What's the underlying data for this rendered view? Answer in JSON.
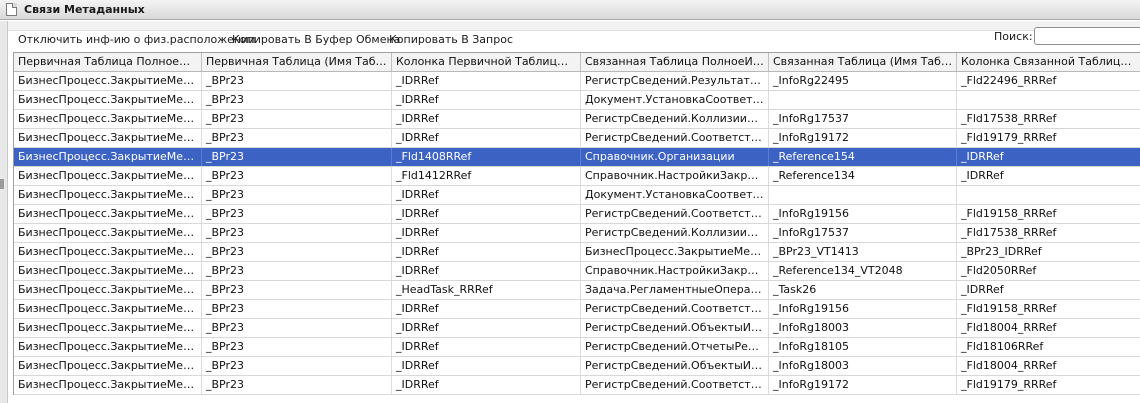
{
  "window": {
    "title": "Связи Метаданных"
  },
  "toolbar": {
    "disable_info": "Отключить инф-ию о физ.расположении",
    "copy_clipboard": "Копировать В Буфер Обмена",
    "copy_query": "Копировать В Запрос"
  },
  "search": {
    "label": "Поиск:",
    "value": ""
  },
  "table": {
    "headers": [
      "Первичная Таблица ПолноеИмя",
      "Первичная Таблица (Имя Таблиц...",
      "Колонка Первичной Таблицы (Им...",
      "Связанная Таблица ПолноеИмя",
      "Связанная Таблица (Имя Таблиц...",
      "Колонка Связанной Таблицы (Им..."
    ],
    "selected_row": 4,
    "rows": [
      [
        "БизнесПроцесс.ЗакрытиеМесяца",
        "_BPr23",
        "_IDRRef",
        "РегистрСведений.РезультатыОб...",
        "_InfoRg22495",
        "_Fld22496_RRRef"
      ],
      [
        "БизнесПроцесс.ЗакрытиеМесяца",
        "_BPr23",
        "_IDRRef",
        "Документ.УстановкаСоответств...",
        "",
        ""
      ],
      [
        "БизнесПроцесс.ЗакрытиеМесяца",
        "_BPr23",
        "_IDRRef",
        "РегистрСведений.КоллизииПриО...",
        "_InfoRg17537",
        "_Fld17538_RRRef"
      ],
      [
        "БизнесПроцесс.ЗакрытиеМесяца",
        "_BPr23",
        "_IDRRef",
        "РегистрСведений.СоответствиеС...",
        "_InfoRg19172",
        "_Fld19179_RRRef"
      ],
      [
        "БизнесПроцесс.ЗакрытиеМесяца",
        "_BPr23",
        "_Fld1408RRef",
        "Справочник.Организации",
        "_Reference154",
        "_IDRRef"
      ],
      [
        "БизнесПроцесс.ЗакрытиеМесяца",
        "_BPr23",
        "_Fld1412RRef",
        "Справочник.НастройкиЗакрытия...",
        "_Reference134",
        "_IDRRef"
      ],
      [
        "БизнесПроцесс.ЗакрытиеМесяца",
        "_BPr23",
        "_IDRRef",
        "Документ.УстановкаСоответств...",
        "",
        ""
      ],
      [
        "БизнесПроцесс.ЗакрытиеМесяца",
        "_BPr23",
        "_IDRRef",
        "РегистрСведений.Соответствие...",
        "_InfoRg19156",
        "_Fld19158_RRRef"
      ],
      [
        "БизнесПроцесс.ЗакрытиеМесяца",
        "_BPr23",
        "_IDRRef",
        "РегистрСведений.КоллизииПриО...",
        "_InfoRg17537",
        "_Fld17538_RRRef"
      ],
      [
        "БизнесПроцесс.ЗакрытиеМесяца",
        "_BPr23",
        "_IDRRef",
        "БизнесПроцесс.ЗакрытиеМесяц...",
        "_BPr23_VT1413",
        "_BPr23_IDRRef"
      ],
      [
        "БизнесПроцесс.ЗакрытиеМесяца",
        "_BPr23",
        "_IDRRef",
        "Справочник.НастройкиЗакрытия...",
        "_Reference134_VT2048",
        "_Fld2050RRef"
      ],
      [
        "БизнесПроцесс.ЗакрытиеМесяца",
        "_BPr23",
        "_HeadTask_RRRef",
        "Задача.РегламентныеОперации...",
        "_Task26",
        "_IDRRef"
      ],
      [
        "БизнесПроцесс.ЗакрытиеМесяца",
        "_BPr23",
        "_IDRRef",
        "РегистрСведений.Соответствие...",
        "_InfoRg19156",
        "_Fld19158_RRRef"
      ],
      [
        "БизнесПроцесс.ЗакрытиеМесяца",
        "_BPr23",
        "_IDRRef",
        "РегистрСведений.ОбъектыИнфо...",
        "_InfoRg18003",
        "_Fld18004_RRRef"
      ],
      [
        "БизнесПроцесс.ЗакрытиеМесяца",
        "_BPr23",
        "_IDRRef",
        "РегистрСведений.ОтчетыРеглам...",
        "_InfoRg18105",
        "_Fld18106RRef"
      ],
      [
        "БизнесПроцесс.ЗакрытиеМесяца",
        "_BPr23",
        "_IDRRef",
        "РегистрСведений.ОбъектыИнфо...",
        "_InfoRg18003",
        "_Fld18004_RRRef"
      ],
      [
        "БизнесПроцесс.ЗакрытиеМесяца",
        "_BPr23",
        "_IDRRef",
        "РегистрСведений.СоответствиеС...",
        "_InfoRg19172",
        "_Fld19179_RRRef"
      ]
    ]
  },
  "colors": {
    "selected_row": "#3c63c4"
  }
}
